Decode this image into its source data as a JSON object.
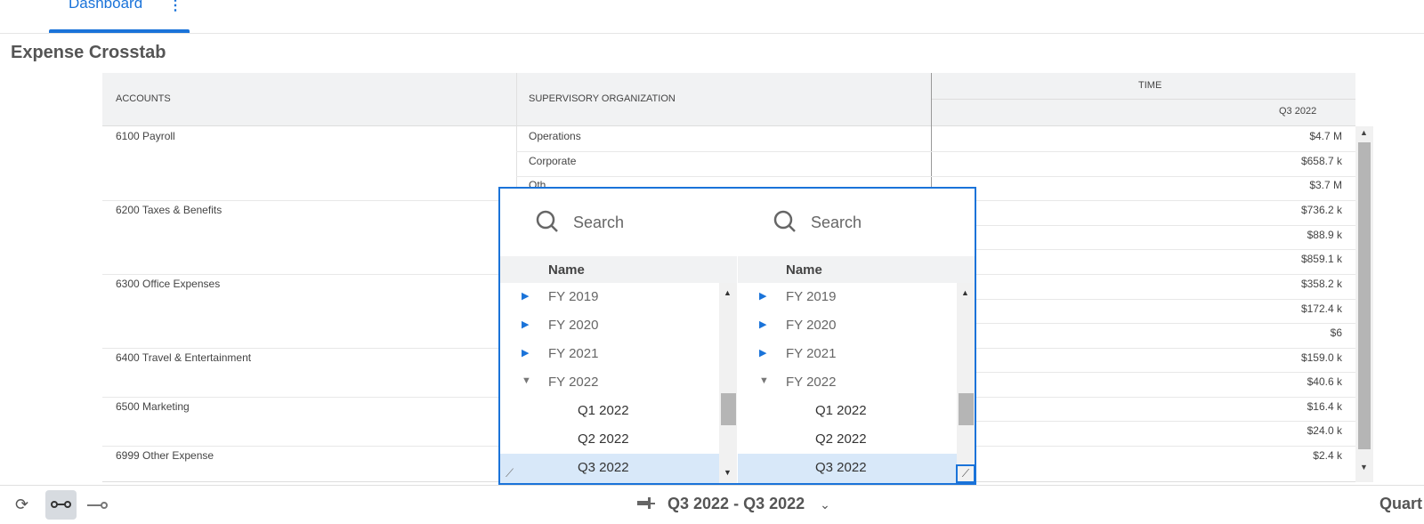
{
  "tab": {
    "label": "Dashboard",
    "menu": "⋮"
  },
  "title": "Expense Crosstab",
  "headers": {
    "accounts": "ACCOUNTS",
    "supervisory": "SUPERVISORY ORGANIZATION",
    "time": "TIME",
    "period": "Q3 2022"
  },
  "accounts": [
    "6100 Payroll",
    "6200 Taxes & Benefits",
    "6300 Office Expenses",
    "6400 Travel & Entertainment",
    "6500 Marketing",
    "6999 Other Expense"
  ],
  "orgs": [
    "Operations",
    "Corporate",
    "Oth"
  ],
  "values": [
    "$4.7 M",
    "$658.7 k",
    "$3.7 M",
    "$736.2 k",
    "$88.9 k",
    "$859.1 k",
    "$358.2 k",
    "$172.4 k",
    "$6",
    "$159.0 k",
    "$40.6 k",
    "$16.4 k",
    "$24.0 k",
    "$2.4 k"
  ],
  "popup": {
    "search_placeholder": "Search",
    "name_header": "Name",
    "items": [
      "FY 2019",
      "FY 2020",
      "FY 2021",
      "FY 2022",
      "Q1 2022",
      "Q2 2022",
      "Q3 2022"
    ]
  },
  "bottom": {
    "range": "Q3 2022 - Q3 2022",
    "right_label": "Quart"
  }
}
